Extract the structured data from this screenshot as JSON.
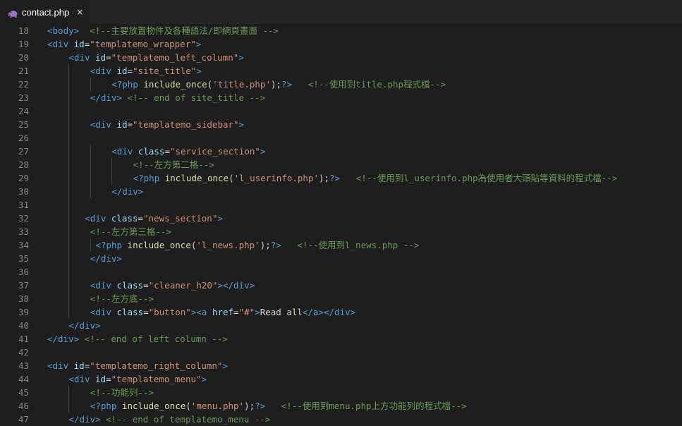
{
  "tab": {
    "title": "contact.php",
    "icon": "php-elephant-icon",
    "close": "×"
  },
  "colors": {
    "tag": "#569cd6",
    "attr": "#9cdcfe",
    "string": "#ce9178",
    "comment": "#6a9955",
    "function": "#dcdcaa",
    "text": "#d4d4d4",
    "line_number": "#858585"
  },
  "lines": [
    {
      "n": "18",
      "indent": 0,
      "tokens": [
        [
          "tag",
          "<body>"
        ],
        [
          "txt",
          "  "
        ],
        [
          "com",
          "<!--主要放置物件及各種語法/即網頁畫面 -->"
        ]
      ]
    },
    {
      "n": "19",
      "indent": 0,
      "tokens": [
        [
          "tag",
          "<div "
        ],
        [
          "attr",
          "id"
        ],
        [
          "txt",
          "="
        ],
        [
          "str",
          "\"templatemo_wrapper\""
        ],
        [
          "tag",
          ">"
        ]
      ]
    },
    {
      "n": "20",
      "indent": 4,
      "tokens": [
        [
          "tag",
          "<div "
        ],
        [
          "attr",
          "id"
        ],
        [
          "txt",
          "="
        ],
        [
          "str",
          "\"templatemo_left_column\""
        ],
        [
          "tag",
          ">"
        ]
      ]
    },
    {
      "n": "21",
      "indent": 8,
      "tokens": [
        [
          "tag",
          "<div "
        ],
        [
          "attr",
          "id"
        ],
        [
          "txt",
          "="
        ],
        [
          "str",
          "\"site_title\""
        ],
        [
          "tag",
          ">"
        ]
      ]
    },
    {
      "n": "22",
      "indent": 12,
      "tokens": [
        [
          "tag",
          "<?php "
        ],
        [
          "fn",
          "include_once"
        ],
        [
          "txt",
          "("
        ],
        [
          "str",
          "'title.php'"
        ],
        [
          "txt",
          ");"
        ],
        [
          "tag",
          "?>"
        ],
        [
          "txt",
          "   "
        ],
        [
          "com",
          "<!--使用到title.php程式檔-->"
        ]
      ]
    },
    {
      "n": "23",
      "indent": 8,
      "tokens": [
        [
          "tag",
          "</div>"
        ],
        [
          "txt",
          " "
        ],
        [
          "com",
          "<!-- end of site_title -->"
        ]
      ]
    },
    {
      "n": "24",
      "indent": 0,
      "tokens": []
    },
    {
      "n": "25",
      "indent": 8,
      "tokens": [
        [
          "tag",
          "<div "
        ],
        [
          "attr",
          "id"
        ],
        [
          "txt",
          "="
        ],
        [
          "str",
          "\"templatemo_sidebar\""
        ],
        [
          "tag",
          ">"
        ]
      ]
    },
    {
      "n": "26",
      "indent": 0,
      "tokens": []
    },
    {
      "n": "27",
      "indent": 12,
      "tokens": [
        [
          "tag",
          "<div "
        ],
        [
          "attr",
          "class"
        ],
        [
          "txt",
          "="
        ],
        [
          "str",
          "\"service_section\""
        ],
        [
          "tag",
          ">"
        ]
      ]
    },
    {
      "n": "28",
      "indent": 16,
      "tokens": [
        [
          "com",
          "<!--左方第二格-->"
        ]
      ]
    },
    {
      "n": "29",
      "indent": 16,
      "tokens": [
        [
          "tag",
          "<?php "
        ],
        [
          "fn",
          "include_once"
        ],
        [
          "txt",
          "("
        ],
        [
          "str",
          "'l_userinfo.php'"
        ],
        [
          "txt",
          ");"
        ],
        [
          "tag",
          "?>"
        ],
        [
          "txt",
          "   "
        ],
        [
          "com",
          "<!--使用到l_userinfo.php為使用者大頭貼等資料的程式檔-->"
        ]
      ]
    },
    {
      "n": "30",
      "indent": 12,
      "tokens": [
        [
          "tag",
          "</div>"
        ]
      ]
    },
    {
      "n": "31",
      "indent": 0,
      "tokens": []
    },
    {
      "n": "32",
      "indent": 7,
      "tokens": [
        [
          "tag",
          "<div "
        ],
        [
          "attr",
          "class"
        ],
        [
          "txt",
          "="
        ],
        [
          "str",
          "\"news_section\""
        ],
        [
          "tag",
          ">"
        ]
      ]
    },
    {
      "n": "33",
      "indent": 8,
      "tokens": [
        [
          "com",
          "<!--左方第三格-->"
        ]
      ]
    },
    {
      "n": "34",
      "indent": 9,
      "tokens": [
        [
          "tag",
          "<?php "
        ],
        [
          "fn",
          "include_once"
        ],
        [
          "txt",
          "("
        ],
        [
          "str",
          "'l_news.php'"
        ],
        [
          "txt",
          ");"
        ],
        [
          "tag",
          "?>"
        ],
        [
          "txt",
          "   "
        ],
        [
          "com",
          "<!--使用到l_news.php -->"
        ]
      ]
    },
    {
      "n": "35",
      "indent": 8,
      "tokens": [
        [
          "tag",
          "</div>"
        ]
      ]
    },
    {
      "n": "36",
      "indent": 0,
      "tokens": []
    },
    {
      "n": "37",
      "indent": 8,
      "tokens": [
        [
          "tag",
          "<div "
        ],
        [
          "attr",
          "class"
        ],
        [
          "txt",
          "="
        ],
        [
          "str",
          "\"cleaner_h20\""
        ],
        [
          "tag",
          "></div>"
        ]
      ]
    },
    {
      "n": "38",
      "indent": 8,
      "tokens": [
        [
          "com",
          "<!--左方底-->"
        ]
      ]
    },
    {
      "n": "39",
      "indent": 8,
      "tokens": [
        [
          "tag",
          "<div "
        ],
        [
          "attr",
          "class"
        ],
        [
          "txt",
          "="
        ],
        [
          "str",
          "\"button\""
        ],
        [
          "tag",
          "><a "
        ],
        [
          "attr",
          "href"
        ],
        [
          "txt",
          "="
        ],
        [
          "str",
          "\"#\""
        ],
        [
          "tag",
          ">"
        ],
        [
          "txt",
          "Read all"
        ],
        [
          "tag",
          "</a></div>"
        ]
      ]
    },
    {
      "n": "40",
      "indent": 4,
      "tokens": [
        [
          "tag",
          "</div>"
        ]
      ]
    },
    {
      "n": "41",
      "indent": 0,
      "tokens": [
        [
          "tag",
          "</div>"
        ],
        [
          "txt",
          " "
        ],
        [
          "com",
          "<!-- end of left column -->"
        ]
      ]
    },
    {
      "n": "42",
      "indent": 0,
      "tokens": []
    },
    {
      "n": "43",
      "indent": 0,
      "tokens": [
        [
          "tag",
          "<div "
        ],
        [
          "attr",
          "id"
        ],
        [
          "txt",
          "="
        ],
        [
          "str",
          "\"templatemo_right_column\""
        ],
        [
          "tag",
          ">"
        ]
      ]
    },
    {
      "n": "44",
      "indent": 4,
      "tokens": [
        [
          "tag",
          "<div "
        ],
        [
          "attr",
          "id"
        ],
        [
          "txt",
          "="
        ],
        [
          "str",
          "\"templatemo_menu\""
        ],
        [
          "tag",
          ">"
        ]
      ]
    },
    {
      "n": "45",
      "indent": 8,
      "tokens": [
        [
          "com",
          "<!--功能列-->"
        ]
      ]
    },
    {
      "n": "46",
      "indent": 8,
      "tokens": [
        [
          "tag",
          "<?php "
        ],
        [
          "fn",
          "include_once"
        ],
        [
          "txt",
          "("
        ],
        [
          "str",
          "'menu.php'"
        ],
        [
          "txt",
          ");"
        ],
        [
          "tag",
          "?>"
        ],
        [
          "txt",
          "   "
        ],
        [
          "com",
          "<!--使用到menu.php上方功能列的程式檔-->"
        ]
      ]
    },
    {
      "n": "47",
      "indent": 4,
      "tokens": [
        [
          "tag",
          "</div>"
        ],
        [
          "txt",
          " "
        ],
        [
          "com",
          "<!-- end of templatemo_menu -->"
        ]
      ]
    }
  ]
}
